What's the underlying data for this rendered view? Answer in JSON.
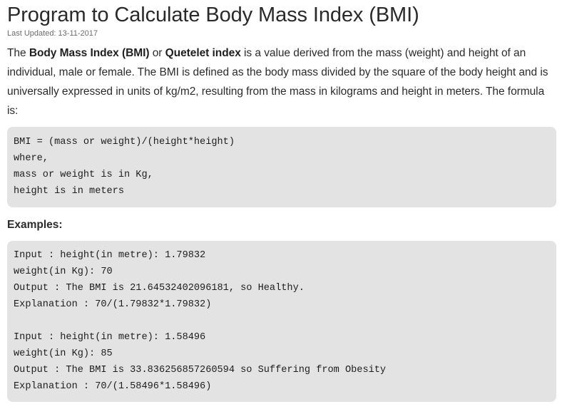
{
  "article": {
    "title": "Program to Calculate Body Mass Index (BMI)",
    "last_updated": "Last Updated: 13-11-2017",
    "intro": {
      "t1": "The ",
      "b1": "Body Mass Index (BMI)",
      "t2": " or ",
      "b2": "Quetelet index",
      "t3": " is a value derived from the mass (weight) and height of an individual, male or female. The BMI is defined as the body mass divided by the square of the body height and is universally expressed in units of kg/m2, resulting from the mass in kilograms and height in meters. The formula is:"
    },
    "formula_lines": [
      "BMI = (mass or weight)/(height*height)",
      "where,",
      "mass or weight is in Kg,",
      "height is in meters"
    ],
    "examples_heading": "Examples:",
    "example_lines": [
      "Input : height(in metre): 1.79832",
      "weight(in Kg): 70",
      "Output : The BMI is 21.64532402096181, so Healthy.",
      "Explanation : 70/(1.79832*1.79832)",
      "",
      "Input : height(in metre): 1.58496",
      "weight(in Kg): 85",
      "Output : The BMI is 33.836256857260594 so Suffering from Obesity",
      "Explanation : 70/(1.58496*1.58496)"
    ]
  }
}
